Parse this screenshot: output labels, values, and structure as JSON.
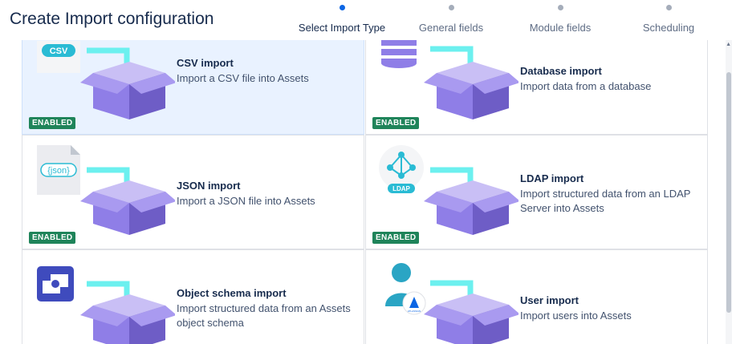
{
  "header": {
    "title": "Create Import configuration",
    "steps": [
      {
        "label": "Select Import Type",
        "active": true
      },
      {
        "label": "General fields",
        "active": false
      },
      {
        "label": "Module fields",
        "active": false
      },
      {
        "label": "Scheduling",
        "active": false
      }
    ]
  },
  "cards": [
    {
      "name": "CSV import",
      "desc": "Import a CSV file into Assets",
      "badge": "ENABLED",
      "source_icon": "csv-tag-icon",
      "icon_text": "CSV",
      "selected": true
    },
    {
      "name": "Database import",
      "desc": "Import data from a database",
      "badge": "ENABLED",
      "source_icon": "database-icon",
      "selected": false
    },
    {
      "name": "JSON import",
      "desc": "Import a JSON file into Assets",
      "badge": "ENABLED",
      "source_icon": "json-file-icon",
      "icon_text": "{json}",
      "selected": false
    },
    {
      "name": "LDAP import",
      "desc": "Import structured data from an LDAP Server into Assets",
      "badge": "ENABLED",
      "source_icon": "ldap-network-icon",
      "icon_text": "LDAP",
      "selected": false
    },
    {
      "name": "Object schema import",
      "desc": "Import structured data from an Assets object schema",
      "badge": "",
      "source_icon": "object-schema-icon",
      "selected": false
    },
    {
      "name": "User import",
      "desc": "Import users into Assets",
      "badge": "",
      "source_icon": "user-atlassian-icon",
      "icon_text": "ATLASSIAN",
      "selected": false
    }
  ],
  "colors": {
    "accent": "#0c66e4",
    "enabled_badge": "#1f845a",
    "box_purple": "#8f7ee7",
    "arrow_teal": "#6cf0ef",
    "csv_tag": "#2abbd4"
  }
}
